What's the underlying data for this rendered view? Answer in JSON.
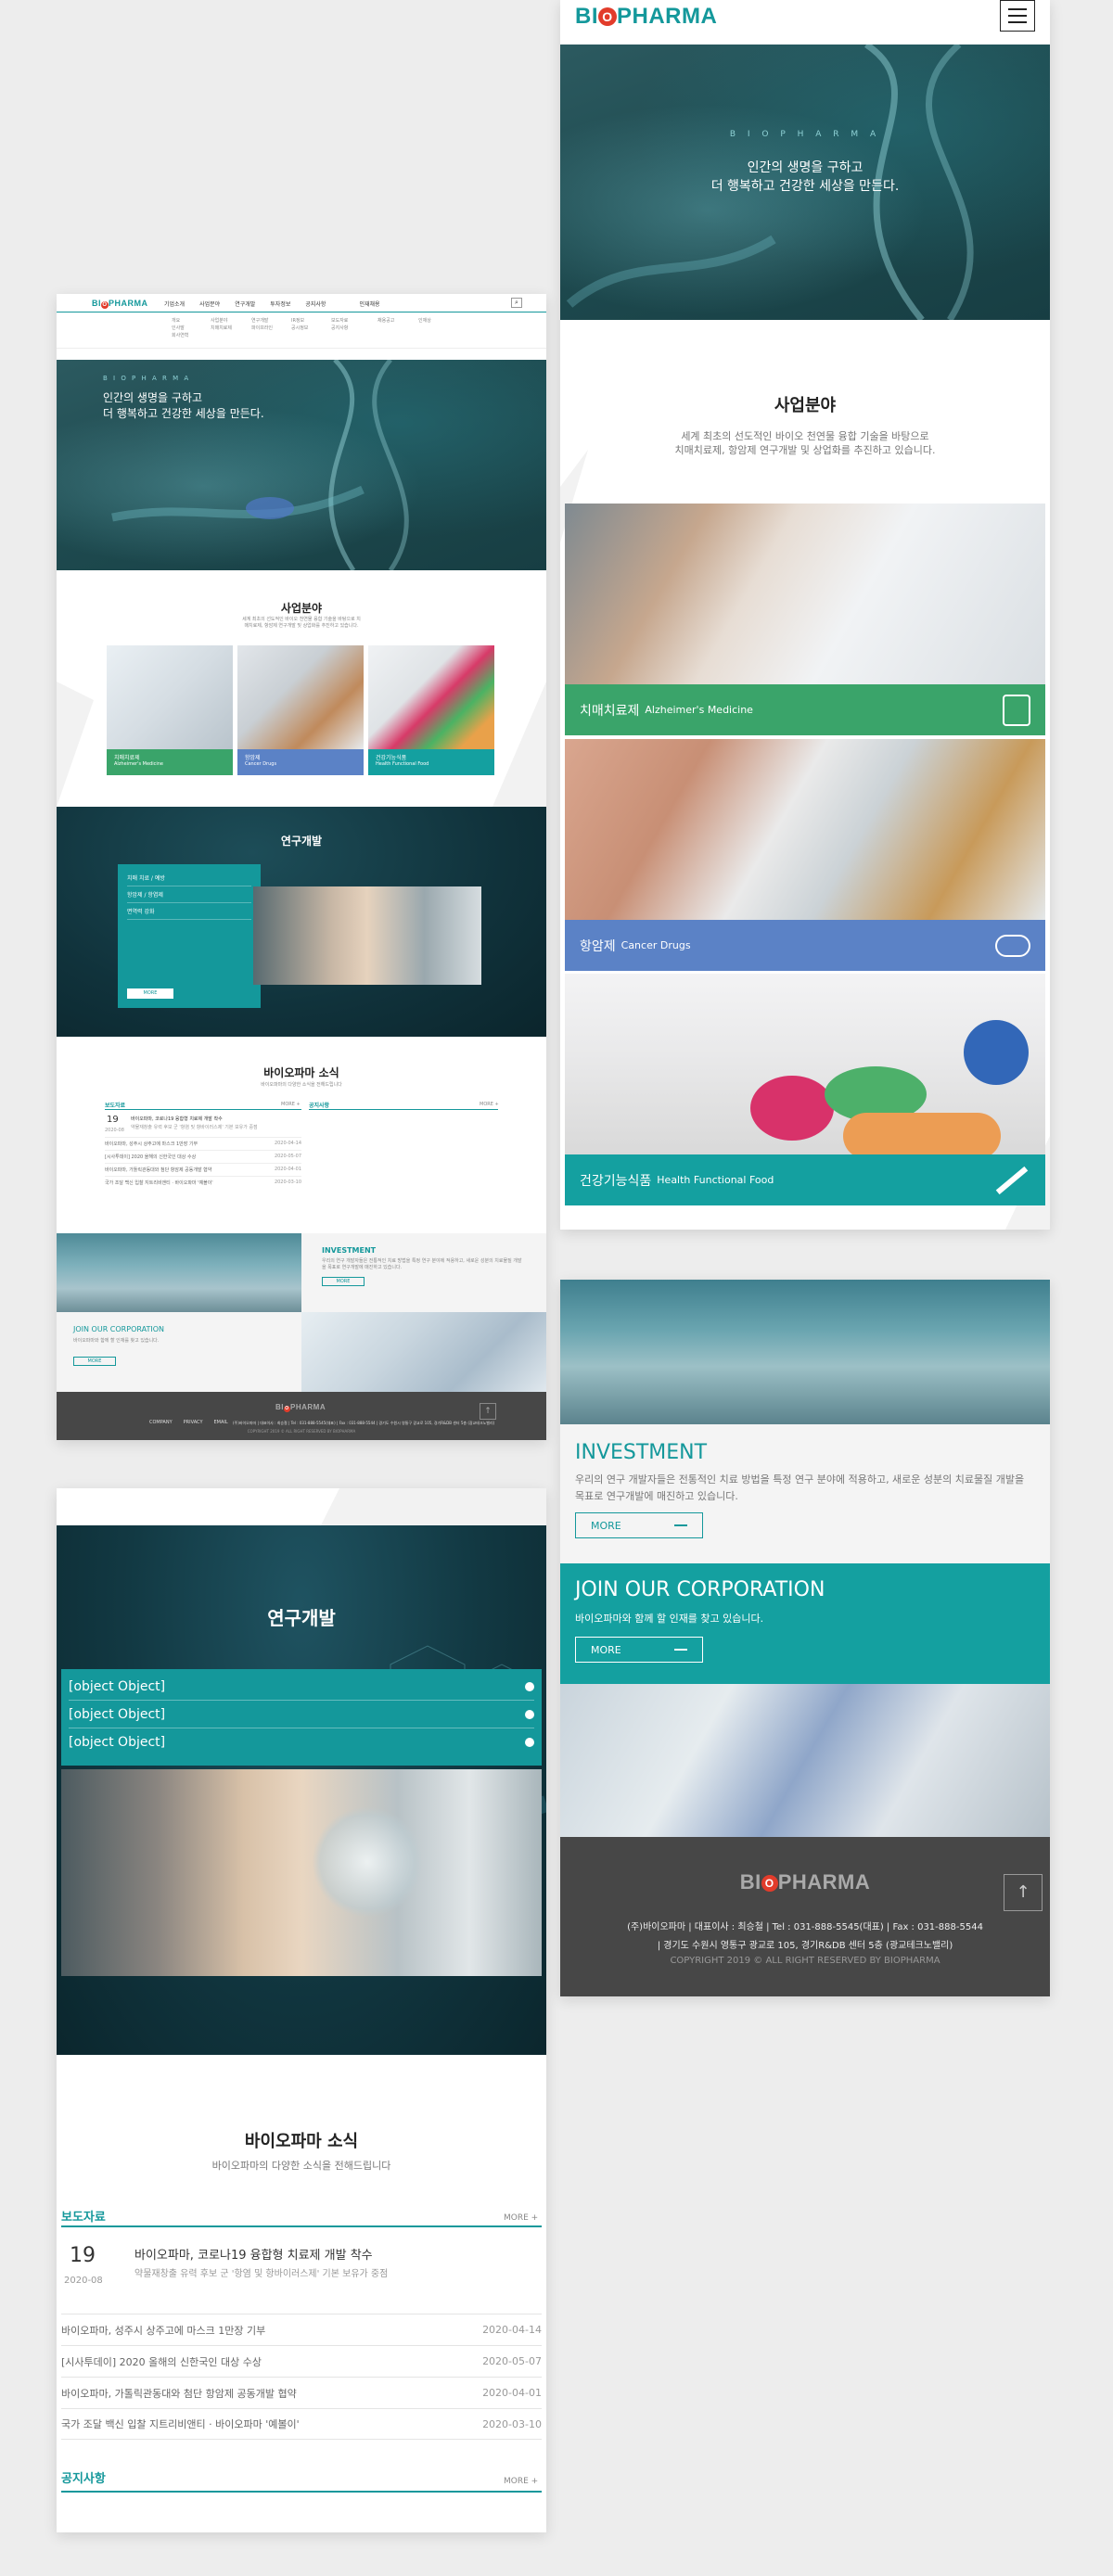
{
  "brand": {
    "logo_bi": "BI",
    "logo_o": "O",
    "logo_rest": "PHARMA",
    "accent": "#14989b",
    "red": "#e23c2b"
  },
  "desktop": {
    "nav": [
      "기업소개",
      "사업분야",
      "연구개발",
      "투자정보",
      "공지사항",
      "인재채용"
    ],
    "nav_search_icon": "search-icon",
    "submenu_cols": [
      [
        "개요",
        "인사말",
        "회사연혁"
      ],
      [
        "사업분야",
        "치매치료제"
      ],
      [
        "연구개발",
        "파이프라인"
      ],
      [
        "IR정보",
        "공시정보"
      ],
      [
        "보도자료",
        "공지사항"
      ],
      [
        "채용공고"
      ],
      [
        "인재상"
      ]
    ],
    "hero": {
      "kicker": "B I O P H A R M A",
      "line1": "인간의 생명을 구하고",
      "line2": "더 행복하고 건강한 세상을 만든다."
    },
    "business": {
      "title": "사업분야",
      "desc": "세계 최초의 선도적인 바이오 천연물 융합 기술을 바탕으로 치매치료제, 항암제 연구개발 및 상업화를 추진하고 있습니다.",
      "cards": [
        {
          "ko": "치매치료제",
          "en": "Alzheimer's Medicine"
        },
        {
          "ko": "항암제",
          "en": "Cancer Drugs"
        },
        {
          "ko": "건강기능식품",
          "en": "Health Functional Food"
        }
      ]
    },
    "rnd": {
      "title": "연구개발",
      "items": [
        "치매 치료 / 예방",
        "항암제 / 항염제",
        "면역력 강화"
      ],
      "more": "MORE"
    },
    "news": {
      "title": "바이오파마 소식",
      "sub": "바이오파마의 다양한 소식을 전해드립니다",
      "press_label": "보도자료",
      "notice_label": "공지사항",
      "more": "MORE +",
      "featured_day": "19",
      "featured_ym": "2020-08",
      "featured_title": "바이오파마, 코로나19 융합형 치료제 개발 착수",
      "featured_desc": "약물재창출 유력 후보 군 '항염 및 항바이러스제' 기본 보유가 중점",
      "items": [
        {
          "title": "바이오파마, 성주시 상주고에 마스크 1만장 기부",
          "date": "2020-04-14"
        },
        {
          "title": "[시사투데이] 2020 올해의 신한국인 대상 수상",
          "date": "2020-05-07"
        },
        {
          "title": "바이오파마, 가톨릭관동대와 첨단 항암제 공동개발 협약",
          "date": "2020-04-01"
        },
        {
          "title": "국가 조달 백신 입찰 지트리비앤티 · 바이오파마 '예볼이'",
          "date": "2020-03-10"
        }
      ]
    },
    "investment": {
      "title": "INVESTMENT",
      "desc": "우리의 연구 개발자들은 전통적인 치료 방법을 특정 연구 분야에 적용하고, 새로운 성분의 치료물질 개발을 목표로 연구개발에 매진하고 있습니다.",
      "more": "MORE"
    },
    "join": {
      "title": "JOIN OUR CORPORATION",
      "desc": "바이오파마와 함께 할 인재를 찾고 있습니다.",
      "more": "MORE"
    },
    "footer": {
      "links": [
        "COMPANY",
        "PRIVACY",
        "EMAIL"
      ],
      "info": "(주)바이오파마 | 대표이사 : 최승철 | Tel : 031-888-5545(대표) | Fax : 031-888-5544 | 경기도 수원시 영통구 광교로 105, 경기R&DB 센터 5층 (광교테크노밸리)",
      "copyright": "COPYRIGHT 2019 © ALL RIGHT RESERVED BY BIOPHARMA"
    }
  },
  "mobile_rnd": {
    "title": "연구개발",
    "items": [
      {
        "title": "바이오파마, 성주시 상주고에 마스크 1만장 기부",
        "date": "2020-04-14"
      },
      {
        "title": "[시사투데이] 2020 올해의 신한국인 대상 수상",
        "date": "2020-05-07"
      },
      {
        "title": "바이오파마, 가톨릭관동대와 첨단 항암제 공동개발 협약",
        "date": "2020-04-01"
      },
      {
        "title": "국가 조달 백신 입찰 지트리비앤티 · 바이오파마 '예볼이'",
        "date": "2020-03-10"
      }
    ],
    "news_title": "바이오파마 소식",
    "news_sub": "바이오파마의 다양한 소식을 전해드립니다",
    "press_label": "보도자료",
    "notice_label": "공지사항",
    "more": "MORE +",
    "featured_day": "19",
    "featured_ym": "2020-08",
    "featured_title": "바이오파마, 코로나19 융합형 치료제 개발 착수",
    "featured_desc": "약물재창출 유력 후보 군 '항염 및 항바이러스제' 기본 보유가 중점"
  },
  "mobile_top": {
    "hero_kicker": "B I O P H A R M A",
    "hero_line1": "인간의 생명을 구하고",
    "hero_line2": "더 행복하고 건강한 세상을 만든다.",
    "biz_title": "사업분야",
    "biz_desc1": "세계 최초의 선도적인 바이오 천연물 융합 기술을 바탕으로",
    "biz_desc2": "치매치료제, 항암제 연구개발 및 상업화를 추진하고 있습니다.",
    "cards": [
      {
        "ko": "치매치료제",
        "en": "Alzheimer's Medicine",
        "color": "#3aa46a",
        "icon": "pill-bottle-icon"
      },
      {
        "ko": "항암제",
        "en": "Cancer Drugs",
        "color": "#5b82c6",
        "icon": "capsule-icon"
      },
      {
        "ko": "건강기능식품",
        "en": "Health Functional Food",
        "color": "#14a0a0",
        "icon": "syringe-icon"
      }
    ]
  },
  "mobile_bottom": {
    "investment_title": "INVESTMENT",
    "investment_desc": "우리의 연구 개발자들은 전통적인 치료 방법을 특정 연구 분야에 적용하고, 새로운 성분의 치료물질 개발을 목표로 연구개발에 매진하고 있습니다.",
    "more": "MORE",
    "join_title": "JOIN OUR CORPORATION",
    "join_desc": "바이오파마와 함께 할 인재를 찾고 있습니다.",
    "footer_line1": "(주)바이오파마 | 대표이사 : 최승철 | Tel : 031-888-5545(대표) | Fax : 031-888-5544",
    "footer_line2": "| 경기도 수원시 영통구 광교로 105, 경기R&DB 센터 5층 (광교테크노밸리)",
    "copyright": "COPYRIGHT 2019 © ALL RIGHT RESERVED BY BIOPHARMA"
  }
}
